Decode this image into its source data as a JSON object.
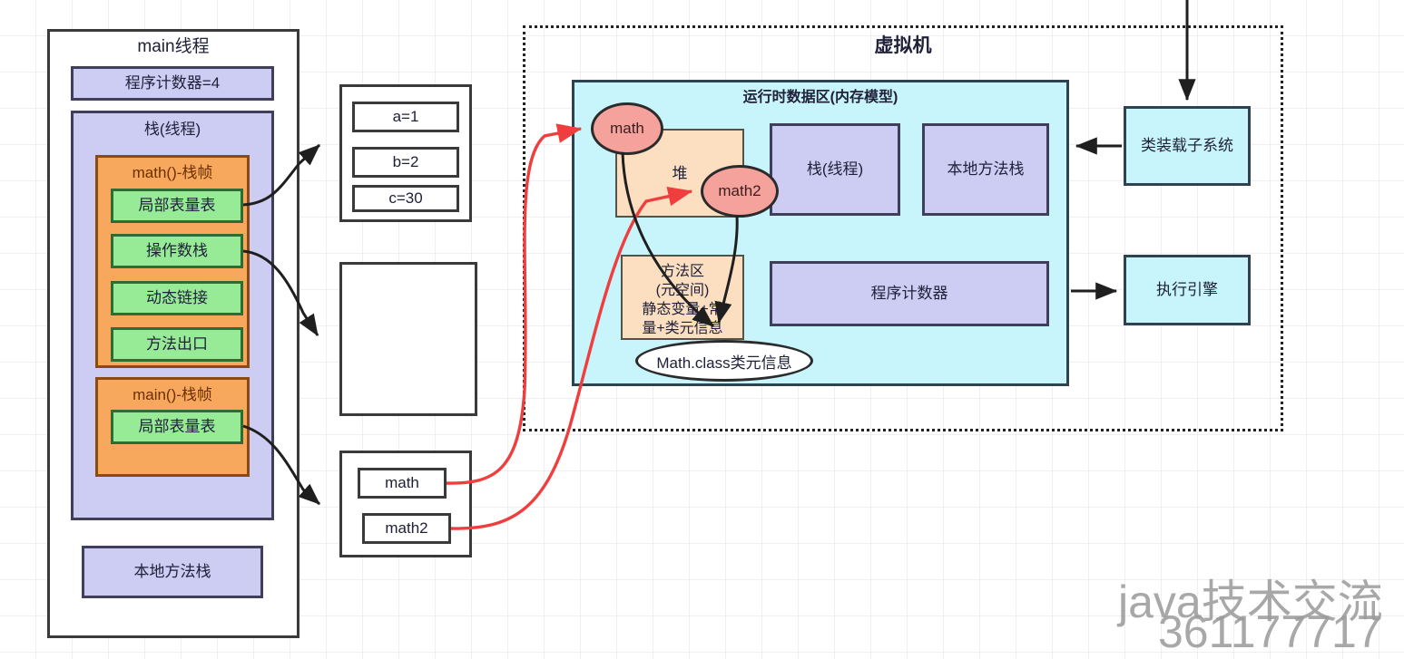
{
  "left_panel": {
    "title": "main线程",
    "program_counter": "程序计数器=4",
    "stack_title": "栈(线程)",
    "frames": [
      {
        "title": "math()-栈帧",
        "items": [
          "局部表量表",
          "操作数栈",
          "动态链接",
          "方法出口"
        ]
      },
      {
        "title": "main()-栈帧",
        "items": [
          "局部表量表"
        ]
      }
    ],
    "native_stack": "本地方法栈"
  },
  "middle": {
    "locals_box": {
      "items": [
        "a=1",
        "b=2",
        "c=30"
      ]
    },
    "empty_box": {
      "label": ""
    },
    "refs_box": {
      "items": [
        "math",
        "math2"
      ]
    }
  },
  "vm_panel": {
    "title": "虚拟机",
    "runtime_area": {
      "title": "运行时数据区(内存模型)",
      "heap": {
        "label": "堆",
        "objects": [
          "math",
          "math2"
        ]
      },
      "method_area": {
        "line1": "方法区",
        "line2": "(元空间)",
        "line3": "静态变量+常",
        "line4": "量+类元信息",
        "class_meta": "Math.class类元信息"
      },
      "stack": "栈(线程)",
      "native_method_stack": "本地方法栈",
      "program_counter": "程序计数器"
    },
    "class_loader": "类装载子系统",
    "execution_engine": "执行引擎"
  },
  "watermark": {
    "line1": "java技术交流",
    "line2": "361177717"
  },
  "colors": {
    "lavender": "#cdcdf4",
    "green": "#97eb97",
    "orange": "#f8a85c",
    "cyan": "#c7f5fb",
    "peach": "#fbdfc0",
    "salmon": "#f5a19c",
    "red_arrow": "#f03e3e",
    "dark_arrow": "#1f1f1f"
  }
}
